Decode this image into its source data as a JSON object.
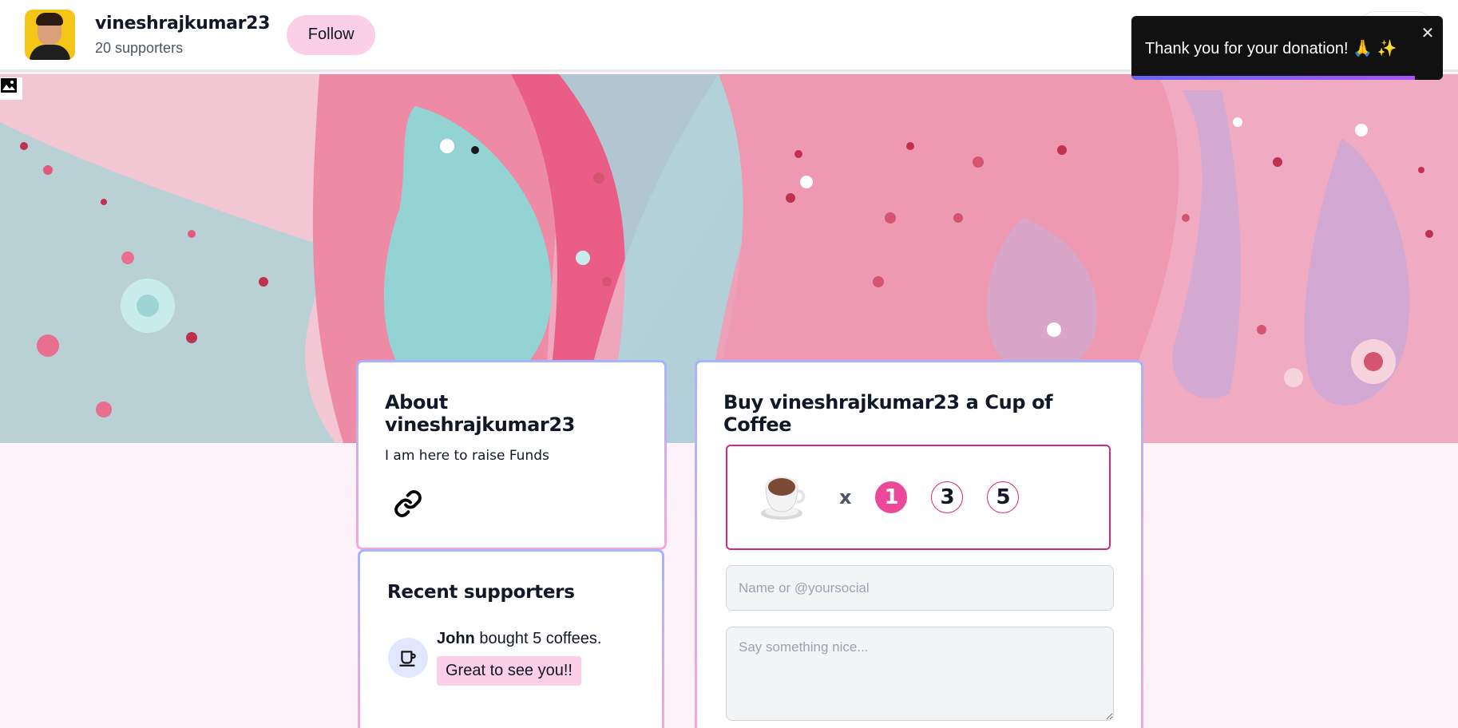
{
  "header": {
    "creator_name": "vineshrajkumar23",
    "supporters_count": "20 supporters",
    "follow_label": "Follow"
  },
  "toast": {
    "message": "Thank you for your donation! 🙏 ✨",
    "close_icon": "close-icon",
    "progress": 0.91
  },
  "about": {
    "title": "About vineshrajkumar23",
    "text": "I am here to raise Funds",
    "link_icon": "link-icon"
  },
  "recent_supporters": {
    "title": "Recent supporters",
    "items": [
      {
        "name": "John",
        "action": " bought 5 coffees.",
        "message": "Great to see you!!"
      }
    ]
  },
  "coffee": {
    "title": "Buy vineshrajkumar23 a Cup of Coffee",
    "multiplier": "x",
    "quantities": [
      "1",
      "3",
      "5"
    ],
    "selected_quantity": "1",
    "name_placeholder": "Name or @yoursocial",
    "message_placeholder": "Say something nice..."
  },
  "colors": {
    "accent_pink": "#ec4899",
    "border_pink": "#db2777",
    "follow_bg": "#fbcfe8",
    "toast_bg": "#111111"
  }
}
